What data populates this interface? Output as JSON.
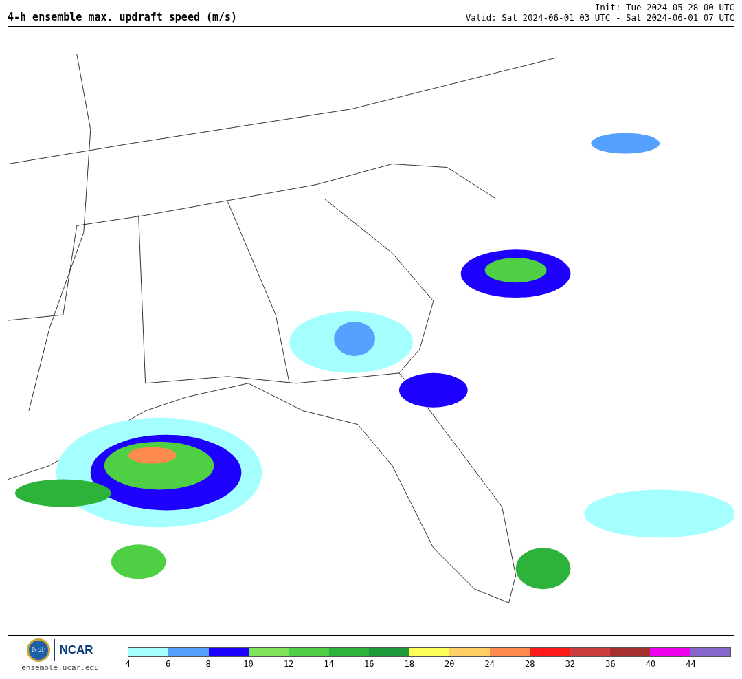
{
  "title": "4-h ensemble max. updraft speed (m/s)",
  "init": "Init: Tue 2024-05-28 00 UTC",
  "valid": "Valid: Sat 2024-06-01 03 UTC - Sat 2024-06-01 07 UTC",
  "logos": {
    "nsf": "NSF",
    "ncar": "NCAR",
    "website": "ensemble.ucar.edu"
  },
  "colorbar": {
    "segments": [
      {
        "color": "#a6ffff"
      },
      {
        "color": "#55a1ff"
      },
      {
        "color": "#1e00ff"
      },
      {
        "color": "#7fe35a"
      },
      {
        "color": "#4fcf44"
      },
      {
        "color": "#2db33a"
      },
      {
        "color": "#1e9a3a"
      },
      {
        "color": "#ffff5c"
      },
      {
        "color": "#ffcf66"
      },
      {
        "color": "#ff8b4f"
      },
      {
        "color": "#ff1a1a"
      },
      {
        "color": "#cc3d3d"
      },
      {
        "color": "#a52f2f"
      },
      {
        "color": "#ee00ee"
      },
      {
        "color": "#8766cc"
      }
    ],
    "ticks": [
      "4",
      "6",
      "8",
      "10",
      "12",
      "14",
      "16",
      "18",
      "20",
      "24",
      "28",
      "32",
      "36",
      "40",
      "44"
    ]
  }
}
